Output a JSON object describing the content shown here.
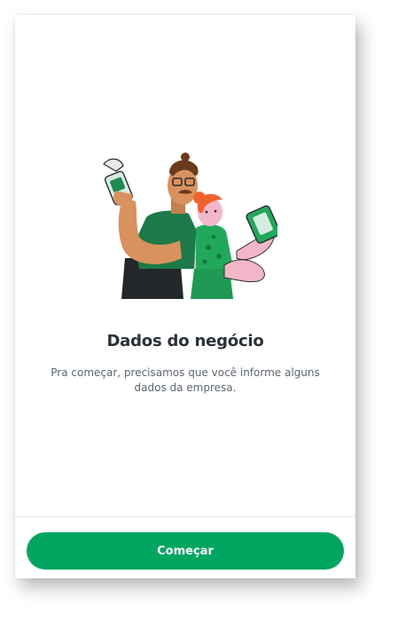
{
  "onboarding": {
    "title": "Dados do negócio",
    "description": "Pra começar, precisamos que você informe alguns dados da empresa.",
    "illustration_icon": "people-with-card-machines-illustration"
  },
  "footer": {
    "start_label": "Começar"
  },
  "colors": {
    "primary": "#00a660",
    "title_text": "#2b3138",
    "body_text": "#5d6670"
  }
}
